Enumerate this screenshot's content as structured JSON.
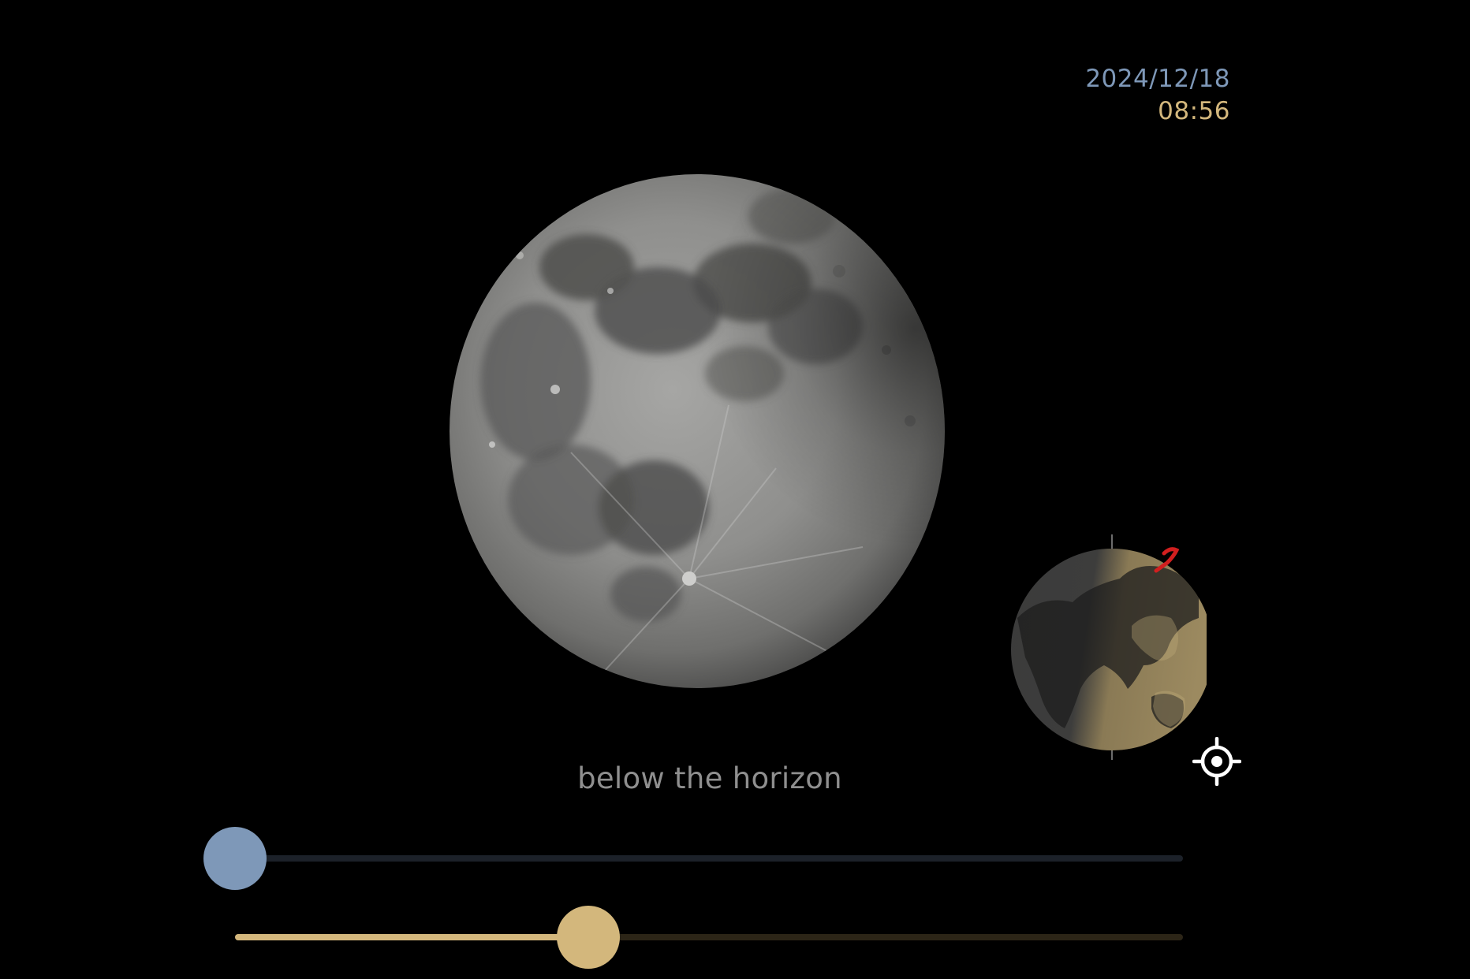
{
  "header": {
    "date": "2024/12/18",
    "time": "08:56"
  },
  "moon": {
    "icon": "moon-image"
  },
  "earth": {
    "icon": "earth-globe"
  },
  "status": {
    "visibility": "below the horizon"
  },
  "controls": {
    "locate_icon": "crosshair-icon",
    "date_slider": {
      "value_fraction": 0.0
    },
    "time_slider": {
      "value_fraction": 0.373
    }
  },
  "colors": {
    "date_accent": "#7e98b8",
    "time_accent": "#d3b77c",
    "background": "#000000",
    "status_text": "#8f8f8f"
  }
}
